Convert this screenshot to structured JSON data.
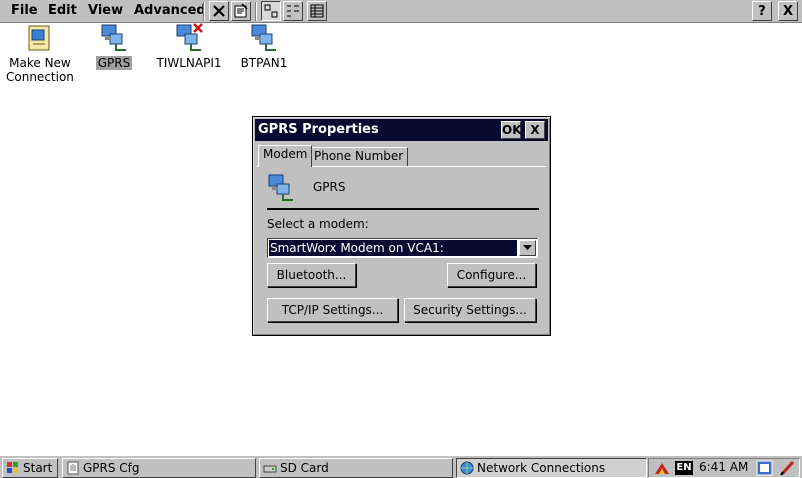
{
  "menubar": {
    "file": "File",
    "edit": "Edit",
    "view": "View",
    "advanced": "Advanced",
    "help_label": "?",
    "close_label": "X"
  },
  "desktop_icons": [
    {
      "label_line1": "Make New",
      "label_line2": "Connection"
    },
    {
      "label": "GPRS"
    },
    {
      "label": "TIWLNAPI1"
    },
    {
      "label": "BTPAN1"
    }
  ],
  "dialog": {
    "title": "GPRS Properties",
    "ok_label": "OK",
    "close_label": "X",
    "tabs": [
      {
        "label": "Modem"
      },
      {
        "label": "Phone Number"
      }
    ],
    "connection_name": "GPRS",
    "select_modem_label": "Select a modem:",
    "selected_modem": "SmartWorx Modem on VCA1:",
    "buttons": {
      "bluetooth": "Bluetooth...",
      "configure": "Configure...",
      "tcpip": "TCP/IP Settings...",
      "security": "Security Settings..."
    }
  },
  "taskbar": {
    "start": "Start",
    "tasks": [
      {
        "label": "GPRS Cfg"
      },
      {
        "label": "SD Card"
      },
      {
        "label": "Network Connections"
      }
    ],
    "language": "EN",
    "clock": "6:41 AM"
  },
  "colors": {
    "face": "#c0c0c0",
    "titlebar": "#0a0a30",
    "selection": "#0a0a30"
  }
}
